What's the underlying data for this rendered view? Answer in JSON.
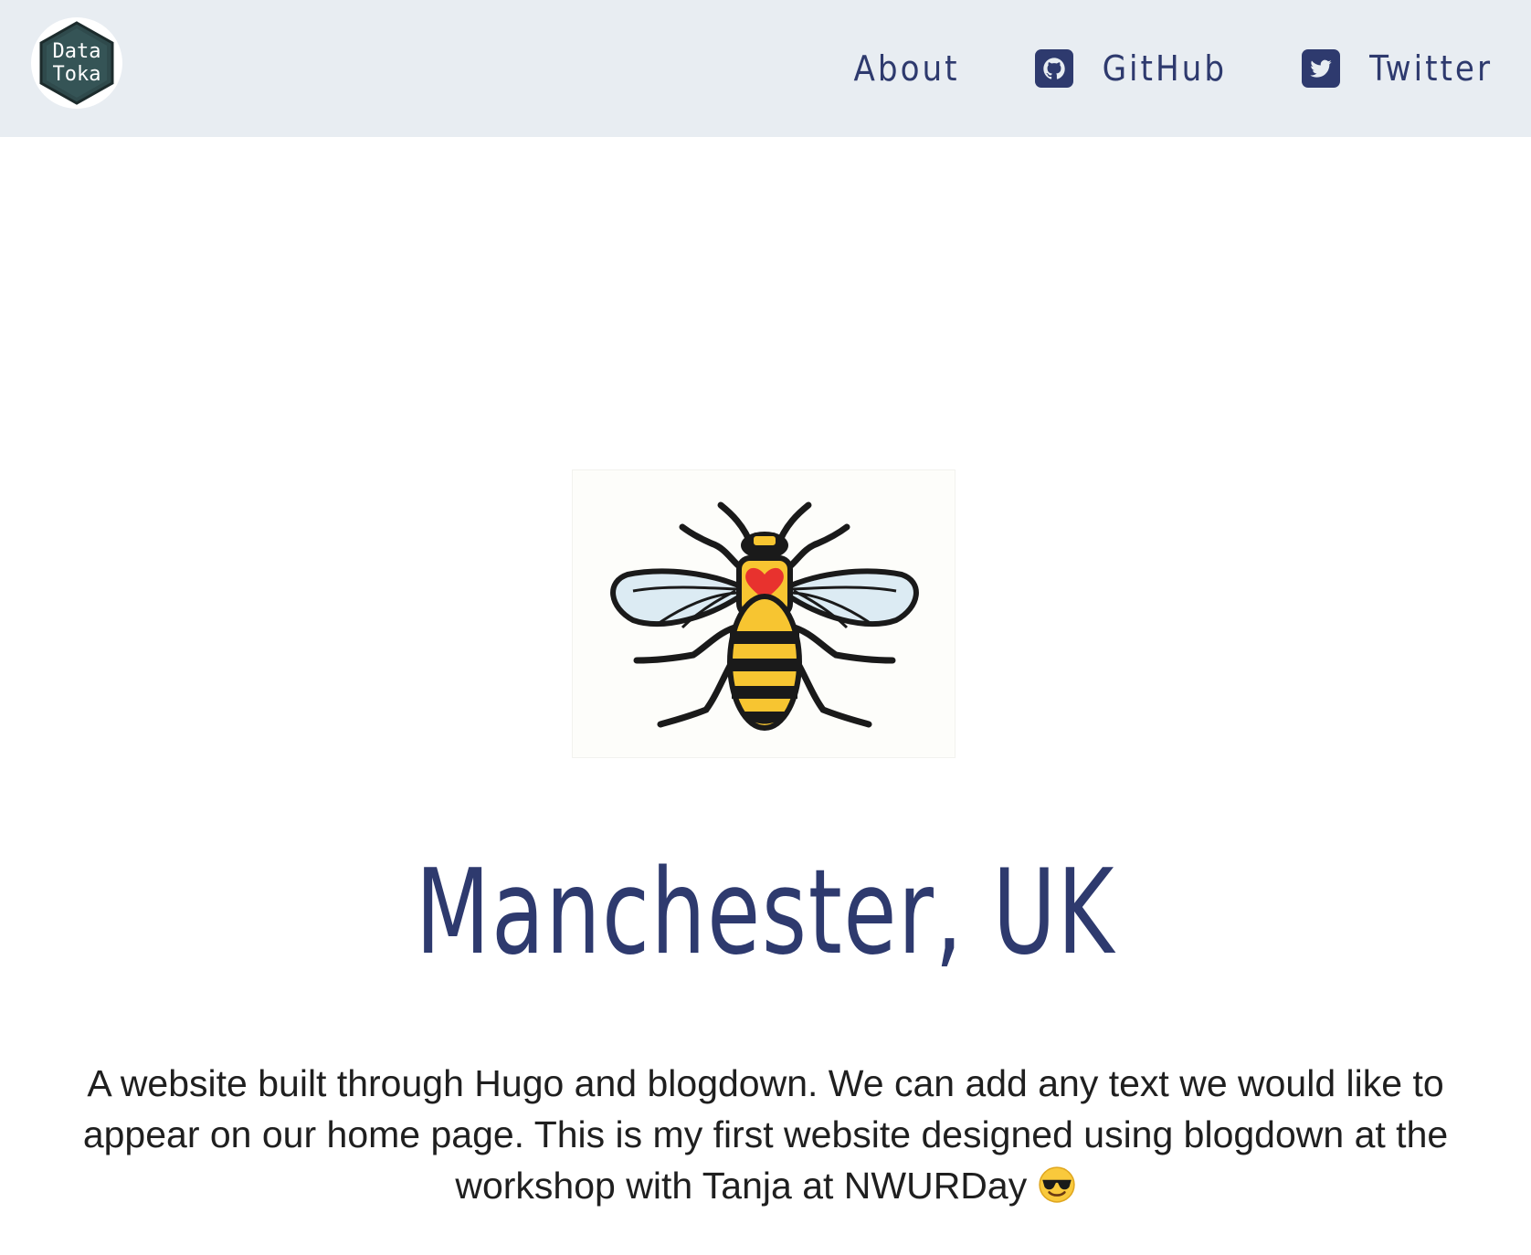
{
  "site": {
    "logo_text_line1": "Data",
    "logo_text_line2": "Toka"
  },
  "nav": {
    "items": [
      {
        "label": "About",
        "icon": null
      },
      {
        "label": "GitHub",
        "icon": "github-icon"
      },
      {
        "label": "Twitter",
        "icon": "twitter-icon"
      }
    ]
  },
  "main": {
    "title": "Manchester, UK",
    "intro": "A website built through Hugo and blogdown. We can add any text we would like to appear on our home page. This is my first website designed using blogdown at the workshop with Tanja at NWURDay",
    "emoji": "smiling-face-with-sunglasses-icon"
  },
  "colors": {
    "navbar_bg": "#e8edf2",
    "accent": "#2e3a6e",
    "bee_yellow": "#f7c531",
    "heart_red": "#e8322e",
    "wing_blue": "#dcebf3"
  }
}
